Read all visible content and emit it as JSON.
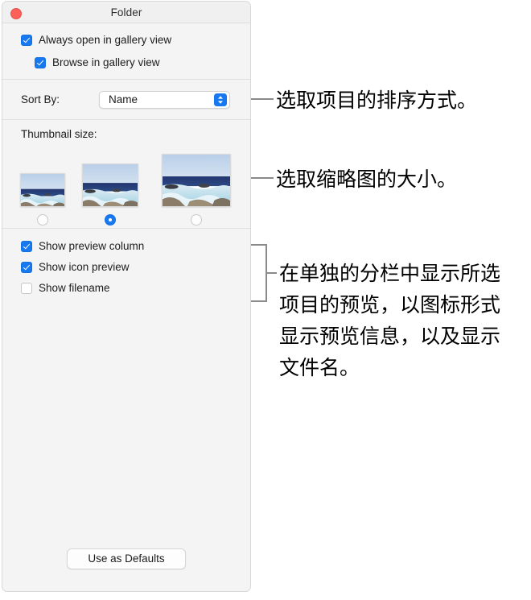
{
  "window": {
    "title": "Folder",
    "close_icon": "close-button-red"
  },
  "gallery_options": [
    {
      "label": "Always open in gallery view",
      "checked": true,
      "indent": 0
    },
    {
      "label": "Browse in gallery view",
      "checked": true,
      "indent": 1
    }
  ],
  "sort": {
    "label": "Sort By:",
    "value": "Name",
    "arrows_icon": "chevron-up-down-icon",
    "accent": "#1878f0"
  },
  "thumbnail": {
    "label": "Thumbnail size:",
    "sizes": [
      {
        "name": "small",
        "selected": false
      },
      {
        "name": "medium",
        "selected": true
      },
      {
        "name": "large",
        "selected": false
      }
    ]
  },
  "preview_options": [
    {
      "label": "Show preview column",
      "checked": true
    },
    {
      "label": "Show icon preview",
      "checked": true
    },
    {
      "label": "Show filename",
      "checked": false
    }
  ],
  "defaults_button": {
    "label": "Use as Defaults"
  },
  "annotations": [
    {
      "text": "选取项目的排序方式。"
    },
    {
      "text": "选取缩略图的大小。"
    },
    {
      "text": "在单独的分栏中显示所选\n项目的预览，以图标形式\n显示预览信息，以及显示\n文件名。"
    }
  ]
}
